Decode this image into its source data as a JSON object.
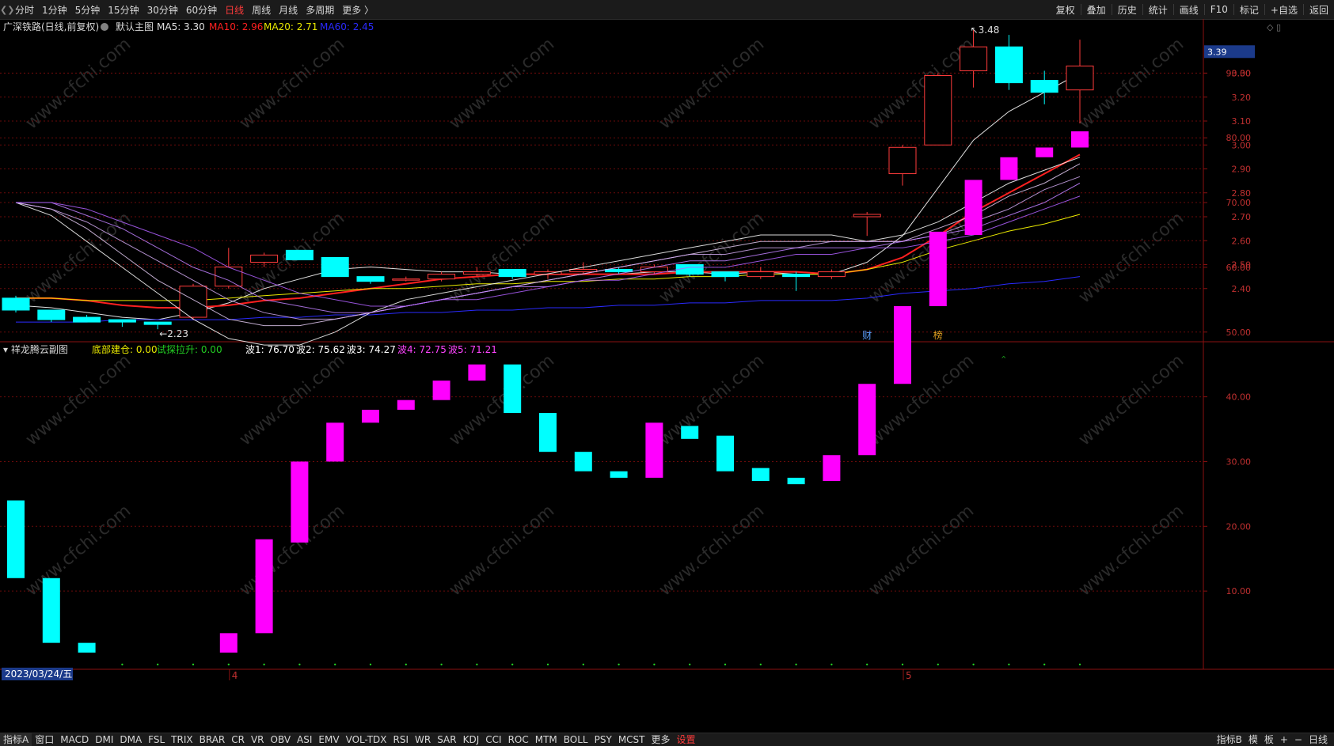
{
  "toolbar": {
    "periods": [
      "分时",
      "1分钟",
      "5分钟",
      "15分钟",
      "30分钟",
      "60分钟",
      "日线",
      "周线",
      "月线",
      "多周期",
      "更多 〉"
    ],
    "active_period": "日线",
    "right_buttons": [
      "复权",
      "叠加",
      "历史",
      "统计",
      "画线",
      "F10",
      "标记",
      "+自选",
      "返回"
    ]
  },
  "main_legend": {
    "stock": "广深铁路(日线,前复权)",
    "template": "默认主图",
    "ma5": "MA5: 3.30",
    "ma10": "MA10: 2.96",
    "ma20": "MA20: 2.71",
    "ma60": "MA60: 2.45"
  },
  "price_tag": "3.39",
  "annotations": {
    "high": "3.48",
    "low": "2.23",
    "event1": "财",
    "event2": "榜"
  },
  "sub_legend": {
    "name": "祥龙腾云副图",
    "items": [
      {
        "text": "底部建仓: 0.00",
        "color": "#e8e800"
      },
      {
        "text": "试探拉升: 0.00",
        "color": "#22cc22"
      },
      {
        "text": "波1: 76.70",
        "color": "#ffffff"
      },
      {
        "text": "波2: 75.62",
        "color": "#ffffff"
      },
      {
        "text": "波3: 74.27",
        "color": "#ffffff"
      },
      {
        "text": "波4: 72.75",
        "color": "#ff44ff"
      },
      {
        "text": "波5: 71.21",
        "color": "#ff44ff"
      }
    ]
  },
  "date_label": "2023/03/24/五",
  "month_labels": [
    "4",
    "5"
  ],
  "watermark": "www.cfchi.com",
  "bottom_tabs": [
    "指标A",
    "窗口",
    "MACD",
    "DMI",
    "DMA",
    "FSL",
    "TRIX",
    "BRAR",
    "CR",
    "VR",
    "OBV",
    "ASI",
    "EMV",
    "VOL-TDX",
    "RSI",
    "WR",
    "SAR",
    "KDJ",
    "CCI",
    "ROC",
    "MTM",
    "BOLL",
    "PSY",
    "MCST",
    "更多",
    "设置"
  ],
  "bottom_right": [
    "指标B",
    "模",
    "板",
    "+",
    "−",
    "日线"
  ],
  "colors": {
    "up": "#ff3b3b",
    "down": "#00ffff",
    "ma5": "#e0e0e0",
    "ma10": "#ff2020",
    "ma20": "#e8e800",
    "ma60": "#2a2aff",
    "bar_up": "#ff00ff",
    "bar_down": "#00ffff",
    "grid": "#6a0a0a"
  },
  "chart_data": [
    {
      "type": "candlestick",
      "title": "广深铁路(日线,前复权)",
      "y_ticks": [
        "3.30",
        "3.20",
        "3.10",
        "3.00",
        "2.90",
        "2.80",
        "2.70",
        "2.60",
        "2.50",
        "2.40"
      ],
      "ylim": [
        2.2,
        3.5
      ],
      "candles": [
        {
          "o": 2.36,
          "h": 2.37,
          "l": 2.3,
          "c": 2.31
        },
        {
          "o": 2.31,
          "h": 2.31,
          "l": 2.26,
          "c": 2.27
        },
        {
          "o": 2.28,
          "h": 2.29,
          "l": 2.26,
          "c": 2.26
        },
        {
          "o": 2.27,
          "h": 2.27,
          "l": 2.24,
          "c": 2.26
        },
        {
          "o": 2.26,
          "h": 2.26,
          "l": 2.23,
          "c": 2.25
        },
        {
          "o": 2.28,
          "h": 2.42,
          "l": 2.27,
          "c": 2.41
        },
        {
          "o": 2.41,
          "h": 2.57,
          "l": 2.4,
          "c": 2.49
        },
        {
          "o": 2.51,
          "h": 2.55,
          "l": 2.49,
          "c": 2.54
        },
        {
          "o": 2.56,
          "h": 2.56,
          "l": 2.52,
          "c": 2.52
        },
        {
          "o": 2.53,
          "h": 2.53,
          "l": 2.45,
          "c": 2.45
        },
        {
          "o": 2.45,
          "h": 2.45,
          "l": 2.42,
          "c": 2.43
        },
        {
          "o": 2.44,
          "h": 2.45,
          "l": 2.43,
          "c": 2.44
        },
        {
          "o": 2.44,
          "h": 2.47,
          "l": 2.43,
          "c": 2.46
        },
        {
          "o": 2.46,
          "h": 2.49,
          "l": 2.45,
          "c": 2.47
        },
        {
          "o": 2.48,
          "h": 2.48,
          "l": 2.44,
          "c": 2.45
        },
        {
          "o": 2.46,
          "h": 2.48,
          "l": 2.44,
          "c": 2.47
        },
        {
          "o": 2.47,
          "h": 2.51,
          "l": 2.46,
          "c": 2.48
        },
        {
          "o": 2.48,
          "h": 2.49,
          "l": 2.46,
          "c": 2.47
        },
        {
          "o": 2.47,
          "h": 2.5,
          "l": 2.46,
          "c": 2.49
        },
        {
          "o": 2.5,
          "h": 2.5,
          "l": 2.45,
          "c": 2.46
        },
        {
          "o": 2.47,
          "h": 2.47,
          "l": 2.43,
          "c": 2.45
        },
        {
          "o": 2.45,
          "h": 2.49,
          "l": 2.44,
          "c": 2.47
        },
        {
          "o": 2.46,
          "h": 2.47,
          "l": 2.39,
          "c": 2.45
        },
        {
          "o": 2.45,
          "h": 2.48,
          "l": 2.44,
          "c": 2.47
        },
        {
          "o": 2.7,
          "h": 2.72,
          "l": 2.62,
          "c": 2.71
        },
        {
          "o": 2.88,
          "h": 3.0,
          "l": 2.83,
          "c": 2.99
        },
        {
          "o": 3.0,
          "h": 3.3,
          "l": 3.0,
          "c": 3.29
        },
        {
          "o": 3.31,
          "h": 3.48,
          "l": 3.24,
          "c": 3.41
        },
        {
          "o": 3.41,
          "h": 3.46,
          "l": 3.23,
          "c": 3.26
        },
        {
          "o": 3.27,
          "h": 3.31,
          "l": 3.17,
          "c": 3.22
        },
        {
          "o": 3.23,
          "h": 3.44,
          "l": 3.09,
          "c": 3.33
        }
      ],
      "series": [
        {
          "name": "MA5",
          "values": [
            2.33,
            2.32,
            2.3,
            2.28,
            2.27,
            2.3,
            2.34,
            2.4,
            2.44,
            2.48,
            2.49,
            2.48,
            2.47,
            2.47,
            2.46,
            2.46,
            2.46,
            2.46,
            2.47,
            2.47,
            2.46,
            2.47,
            2.46,
            2.46,
            2.51,
            2.62,
            2.82,
            3.02,
            3.14,
            3.22,
            3.3
          ]
        },
        {
          "name": "MA10",
          "values": [
            2.36,
            2.36,
            2.35,
            2.33,
            2.32,
            2.32,
            2.33,
            2.35,
            2.36,
            2.38,
            2.4,
            2.42,
            2.44,
            2.45,
            2.46,
            2.46,
            2.46,
            2.46,
            2.46,
            2.47,
            2.47,
            2.47,
            2.47,
            2.46,
            2.48,
            2.53,
            2.62,
            2.72,
            2.8,
            2.88,
            2.96
          ]
        },
        {
          "name": "MA20",
          "values": [
            2.36,
            2.36,
            2.35,
            2.35,
            2.35,
            2.35,
            2.36,
            2.37,
            2.38,
            2.39,
            2.4,
            2.4,
            2.41,
            2.42,
            2.42,
            2.43,
            2.43,
            2.44,
            2.44,
            2.45,
            2.45,
            2.46,
            2.46,
            2.46,
            2.48,
            2.51,
            2.56,
            2.6,
            2.64,
            2.67,
            2.71
          ]
        },
        {
          "name": "MA60",
          "values": [
            2.26,
            2.26,
            2.26,
            2.27,
            2.27,
            2.27,
            2.27,
            2.28,
            2.28,
            2.29,
            2.29,
            2.3,
            2.3,
            2.31,
            2.31,
            2.32,
            2.32,
            2.33,
            2.33,
            2.34,
            2.34,
            2.35,
            2.35,
            2.35,
            2.36,
            2.38,
            2.39,
            2.4,
            2.42,
            2.43,
            2.45
          ]
        }
      ]
    },
    {
      "type": "bar",
      "title": "祥龙腾云副图",
      "y_ticks": [
        "90.00",
        "80.00",
        "70.00",
        "60.00",
        "50.00",
        "40.00",
        "30.00",
        "20.00",
        "10.00"
      ],
      "ylim": [
        0,
        100
      ],
      "bars": [
        {
          "from": 24,
          "to": 12,
          "dir": "down"
        },
        {
          "from": 12,
          "to": 2,
          "dir": "down"
        },
        {
          "from": 2,
          "to": 0.5,
          "dir": "down"
        },
        {
          "from": 0,
          "to": 0,
          "dir": "none"
        },
        {
          "from": 0,
          "to": 0,
          "dir": "none"
        },
        {
          "from": 0,
          "to": 0,
          "dir": "none"
        },
        {
          "from": 0.5,
          "to": 3.5,
          "dir": "up"
        },
        {
          "from": 3.5,
          "to": 18,
          "dir": "up"
        },
        {
          "from": 17.5,
          "to": 30,
          "dir": "up"
        },
        {
          "from": 30,
          "to": 36,
          "dir": "up"
        },
        {
          "from": 36,
          "to": 38,
          "dir": "up"
        },
        {
          "from": 38,
          "to": 39.5,
          "dir": "up"
        },
        {
          "from": 39.5,
          "to": 42.5,
          "dir": "up"
        },
        {
          "from": 42.5,
          "to": 45,
          "dir": "up"
        },
        {
          "from": 45,
          "to": 37.5,
          "dir": "down"
        },
        {
          "from": 37.5,
          "to": 31.5,
          "dir": "down"
        },
        {
          "from": 31.5,
          "to": 28.5,
          "dir": "down"
        },
        {
          "from": 28.5,
          "to": 27.5,
          "dir": "down"
        },
        {
          "from": 27.5,
          "to": 36,
          "dir": "up"
        },
        {
          "from": 35.5,
          "to": 33.5,
          "dir": "down"
        },
        {
          "from": 34,
          "to": 28.5,
          "dir": "down"
        },
        {
          "from": 29,
          "to": 27,
          "dir": "down"
        },
        {
          "from": 27.5,
          "to": 26.5,
          "dir": "down"
        },
        {
          "from": 27,
          "to": 31,
          "dir": "up"
        },
        {
          "from": 31,
          "to": 42,
          "dir": "up"
        },
        {
          "from": 42,
          "to": 54,
          "dir": "up"
        },
        {
          "from": 54,
          "to": 65.5,
          "dir": "up"
        },
        {
          "from": 65,
          "to": 73.5,
          "dir": "up"
        },
        {
          "from": 73.5,
          "to": 77,
          "dir": "up"
        },
        {
          "from": 77,
          "to": 78.5,
          "dir": "up"
        },
        {
          "from": 78.5,
          "to": 81,
          "dir": "up"
        }
      ],
      "series": [
        {
          "name": "波1",
          "values": [
            70,
            68,
            64,
            60,
            56,
            52,
            49,
            48,
            48,
            50,
            53,
            55,
            56,
            57,
            58,
            59,
            60,
            61,
            62,
            63,
            64,
            65,
            65,
            65,
            64,
            65,
            67,
            70,
            73,
            75,
            77
          ]
        },
        {
          "name": "波2",
          "values": [
            70,
            69,
            66,
            62,
            58,
            55,
            52,
            51,
            51,
            52,
            53,
            54,
            55,
            56,
            57,
            58,
            59,
            60,
            61,
            62,
            63,
            64,
            64,
            64,
            64,
            64,
            66,
            68,
            71,
            73,
            76
          ]
        },
        {
          "name": "波3",
          "values": [
            70,
            69,
            67,
            64,
            61,
            58,
            55,
            53,
            52,
            52,
            53,
            54,
            55,
            56,
            57,
            58,
            59,
            60,
            61,
            62,
            62,
            63,
            63,
            64,
            64,
            64,
            65,
            67,
            69,
            72,
            74
          ]
        },
        {
          "name": "波4",
          "values": [
            70,
            70,
            68,
            66,
            63,
            60,
            58,
            55,
            54,
            53,
            53,
            54,
            55,
            56,
            57,
            57,
            58,
            59,
            60,
            61,
            61,
            62,
            63,
            63,
            63,
            64,
            65,
            66,
            68,
            70,
            73
          ]
        },
        {
          "name": "波5",
          "values": [
            70,
            70,
            69,
            67,
            65,
            63,
            60,
            58,
            56,
            55,
            54,
            54,
            55,
            55,
            56,
            57,
            58,
            58,
            59,
            60,
            60,
            61,
            62,
            62,
            63,
            63,
            64,
            65,
            67,
            69,
            71
          ]
        }
      ]
    }
  ]
}
